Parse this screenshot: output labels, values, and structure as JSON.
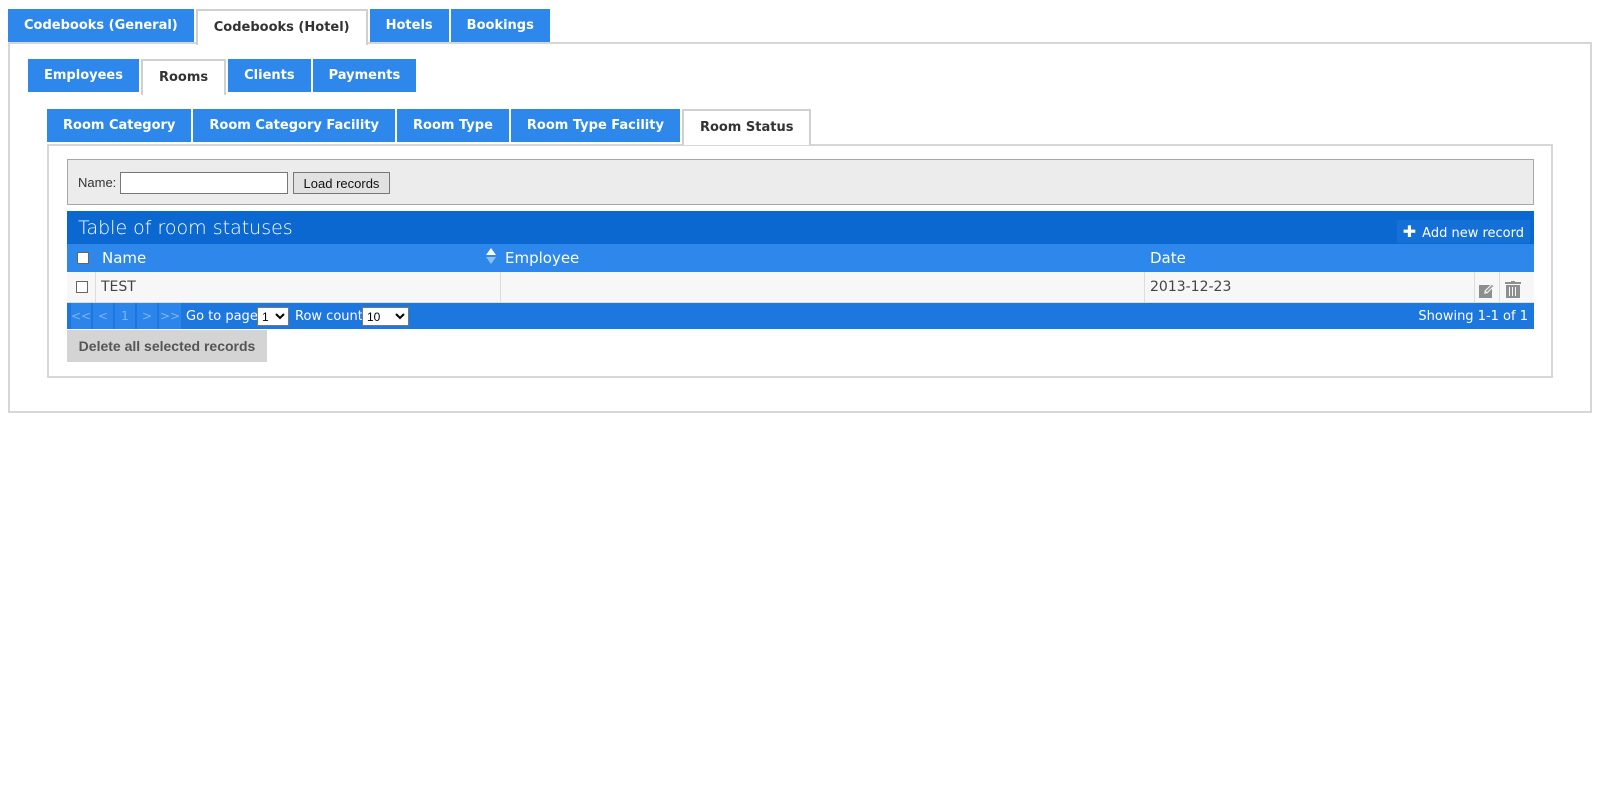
{
  "top_tabs": [
    {
      "label": "Codebooks (General)",
      "active": false
    },
    {
      "label": "Codebooks (Hotel)",
      "active": true
    },
    {
      "label": "Hotels",
      "active": false
    },
    {
      "label": "Bookings",
      "active": false
    }
  ],
  "second_tabs": [
    {
      "label": "Employees",
      "active": false
    },
    {
      "label": "Rooms",
      "active": true
    },
    {
      "label": "Clients",
      "active": false
    },
    {
      "label": "Payments",
      "active": false
    }
  ],
  "third_tabs": [
    {
      "label": "Room Category",
      "active": false
    },
    {
      "label": "Room Category Facility",
      "active": false
    },
    {
      "label": "Room Type",
      "active": false
    },
    {
      "label": "Room Type Facility",
      "active": false
    },
    {
      "label": "Room Status",
      "active": true
    }
  ],
  "filter": {
    "name_label": "Name:",
    "name_value": "",
    "load_button": "Load records"
  },
  "table": {
    "title": "Table of room statuses",
    "add_button": "Add new record",
    "columns": [
      "Name",
      "Employee",
      "Date"
    ],
    "rows": [
      {
        "name": "TEST",
        "employee": "",
        "date": "2013-12-23"
      }
    ]
  },
  "pager": {
    "first": "<<",
    "prev": "<",
    "current": "1",
    "next": ">",
    "last": ">>",
    "goto_label": "Go to page:",
    "goto_value": "1",
    "rowcount_label": "Row count:",
    "rowcount_value": "10",
    "showing": "Showing 1-1 of 1"
  },
  "delete_all_button": "Delete all selected records",
  "colors": {
    "tab_blue": "#2e88ec",
    "title_blue": "#0b68d0",
    "pager_blue": "#1c77de"
  }
}
